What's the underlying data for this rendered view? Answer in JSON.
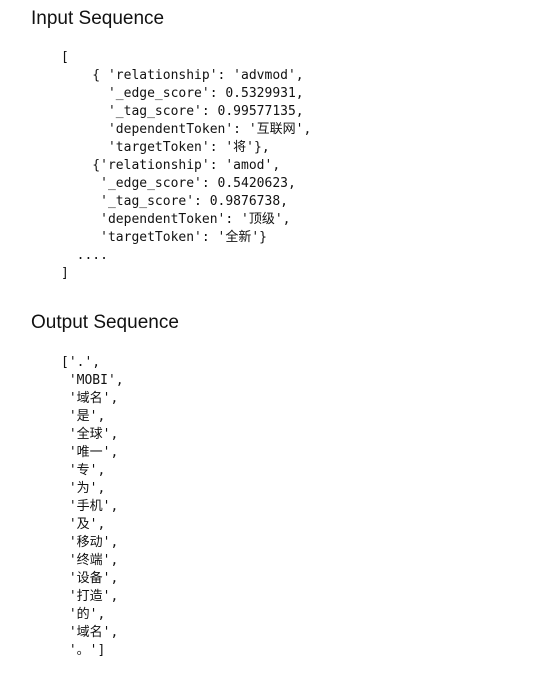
{
  "input_section": {
    "heading": "Input Sequence",
    "code_lines": [
      "[",
      "    { 'relationship': 'advmod',",
      "      '_edge_score': 0.5329931,",
      "      '_tag_score': 0.99577135,",
      "      'dependentToken': '互联网',",
      "      'targetToken': '将'},",
      "    {'relationship': 'amod',",
      "     '_edge_score': 0.5420623,",
      "     '_tag_score': 0.9876738,",
      "     'dependentToken': '顶级',",
      "     'targetToken': '全新'}",
      "  ....",
      "]"
    ]
  },
  "output_section": {
    "heading": "Output Sequence",
    "code_lines": [
      "['.',",
      " 'MOBI',",
      " '域名',",
      " '是',",
      " '全球',",
      " '唯一',",
      " '专',",
      " '为',",
      " '手机',",
      " '及',",
      " '移动',",
      " '终端',",
      " '设备',",
      " '打造',",
      " '的',",
      " '域名',",
      " '。']"
    ]
  }
}
